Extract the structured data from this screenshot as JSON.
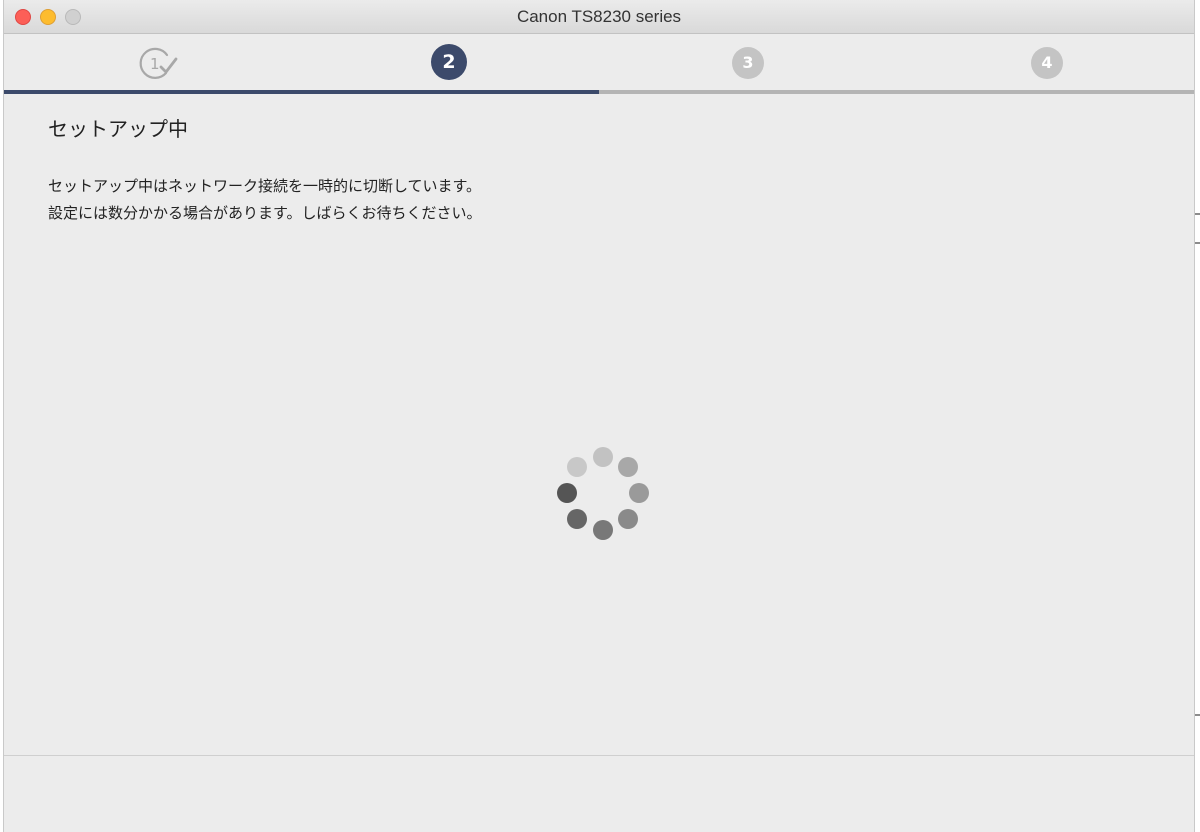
{
  "window": {
    "title": "Canon TS8230 series"
  },
  "steps": [
    {
      "label": "1",
      "state": "done",
      "icon": "check-icon"
    },
    {
      "label": "2",
      "state": "active"
    },
    {
      "label": "3",
      "state": "pending"
    },
    {
      "label": "4",
      "state": "pending"
    }
  ],
  "progress": {
    "fraction": 0.5
  },
  "content": {
    "heading": "セットアップ中",
    "description_line1": "セットアップ中はネットワーク接続を一時的に切断しています。",
    "description_line2": "設定には数分かかる場合があります。しばらくお待ちください。"
  },
  "spinner": {
    "icon": "loading-spinner-icon"
  },
  "colors": {
    "accent": "#3c4a6b",
    "inactive_step": "#c4c4c4",
    "close": "#fc5f57",
    "minimize": "#fdbc2e",
    "zoom": "#d0d0d0"
  }
}
